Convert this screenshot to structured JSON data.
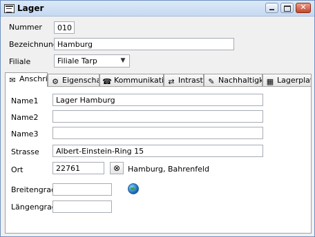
{
  "window": {
    "title": "Lager"
  },
  "header": {
    "nummer_label": "Nummer",
    "nummer_value": "010",
    "bezeichnung_label": "Bezeichnung",
    "bezeichnung_value": "Hamburg",
    "filiale_label": "Filiale",
    "filiale_value": "Filiale Tarp"
  },
  "tabs": [
    {
      "label": "Anschrift",
      "icon": "address-icon",
      "active": true
    },
    {
      "label": "Eigenschaft",
      "icon": "properties-icon"
    },
    {
      "label": "Kommunikation",
      "icon": "communication-icon"
    },
    {
      "label": "Intrastat",
      "icon": "intrastat-icon"
    },
    {
      "label": "Nachhaltigkeit",
      "icon": "sustainability-icon"
    },
    {
      "label": "Lagerplatz",
      "icon": "storage-location-icon"
    }
  ],
  "form": {
    "name1_label": "Name1",
    "name1_value": "Lager Hamburg",
    "name2_label": "Name2",
    "name2_value": "",
    "name3_label": "Name3",
    "name3_value": "",
    "strasse_label": "Strasse",
    "strasse_value": "Albert-Einstein-Ring 15",
    "ort_label": "Ort",
    "ort_value": "22761",
    "ort_result": "Hamburg, Bahrenfeld",
    "breitengrad_label": "Breitengrad",
    "breitengrad_value": "",
    "laengengrad_label": "Längengrad",
    "laengengrad_value": ""
  }
}
